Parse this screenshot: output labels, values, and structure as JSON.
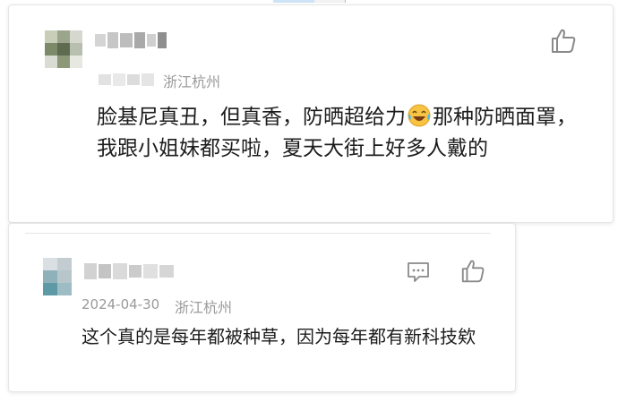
{
  "comments": [
    {
      "location": "浙江杭州",
      "text_before_emoji": "脸基尼真丑，但真香，防晒超给力",
      "emoji": "😂",
      "text_after_emoji": "那种防晒面罩，我跟小姐妹都买啦，夏天大街上好多人戴的"
    },
    {
      "date": "2024-04-30",
      "location": "浙江杭州",
      "text": "这个真的是每年都被种草，因为每年都有新科技欸"
    }
  ],
  "icons": {
    "like": "thumbs-up-icon",
    "reply": "comment-icon"
  },
  "colors": {
    "text": "#1c1c1c",
    "meta": "#9a9a9a",
    "emoji_face": "#f6c343"
  }
}
